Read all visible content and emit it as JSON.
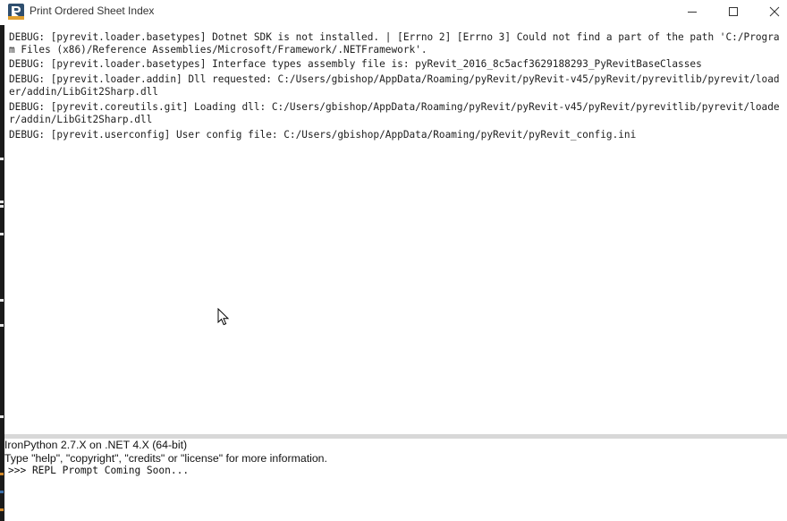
{
  "window": {
    "title": "Print Ordered Sheet Index",
    "controls": {
      "minimize_icon": "minimize-icon",
      "maximize_icon": "maximize-icon",
      "close_icon": "close-icon"
    }
  },
  "output": {
    "lines": [
      "DEBUG: [pyrevit.loader.basetypes] Dotnet SDK is not installed. | [Errno 2] [Errno 3] Could not find a part of the path 'C:/Program Files (x86)/Reference Assemblies/Microsoft/Framework/.NETFramework'.",
      "DEBUG: [pyrevit.loader.basetypes] Interface types assembly file is: pyRevit_2016_8c5acf3629188293_PyRevitBaseClasses",
      "DEBUG: [pyrevit.loader.addin] Dll requested: C:/Users/gbishop/AppData/Roaming/pyRevit/pyRevit-v45/pyRevit/pyrevitlib/pyrevit/loader/addin/LibGit2Sharp.dll",
      "DEBUG: [pyrevit.coreutils.git] Loading dll: C:/Users/gbishop/AppData/Roaming/pyRevit/pyRevit-v45/pyRevit/pyrevitlib/pyrevit/loader/addin/LibGit2Sharp.dll",
      "DEBUG: [pyrevit.userconfig] User config file: C:/Users/gbishop/AppData/Roaming/pyRevit/pyRevit_config.ini"
    ]
  },
  "repl": {
    "banner": "IronPython 2.7.X on .NET 4.X (64-bit)",
    "help": "Type \"help\", \"copyright\", \"credits\" or \"license\" for more information.",
    "prompt": ">>> REPL Prompt Coming Soon..."
  },
  "colors": {
    "text": "#202020",
    "splitter": "#d8d8d8",
    "left_strip": "#1b1b1b"
  }
}
